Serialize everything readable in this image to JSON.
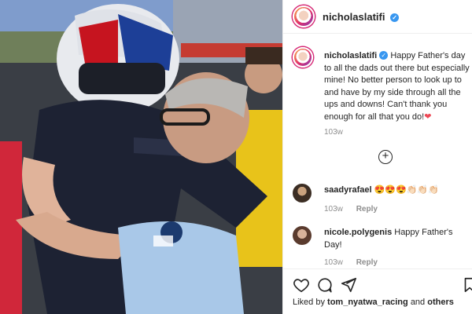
{
  "post": {
    "username": "nicholaslatifi",
    "verified_mark": "✓",
    "caption_text": "Happy Father's day to all the dads out there but especially mine! No better person to look up to and have by my side through all the ups and downs! Can't thank you enough for all that you do!",
    "caption_emoji": "❤",
    "caption_age": "103w"
  },
  "add_comment_glyph": "+",
  "comments": [
    {
      "username": "saadyrafael",
      "text": "😍😍😍👏🏻👏🏻👏🏻",
      "age": "103w",
      "reply_label": "Reply"
    },
    {
      "username": "nicole.polygenis",
      "text": "Happy Father's Day!",
      "age": "103w",
      "reply_label": "Reply"
    }
  ],
  "likes": {
    "prefix": "Liked by",
    "user": "tom_nyatwa_racing",
    "joiner": "and",
    "others": "others"
  },
  "icons": {
    "like": "heart-icon",
    "comment": "comment-icon",
    "share": "send-icon",
    "add": "add-comment-icon"
  },
  "colors": {
    "verified": "#3897f0",
    "heart": "#ed4956",
    "meta": "#8e8e8e",
    "border": "#efefef"
  }
}
